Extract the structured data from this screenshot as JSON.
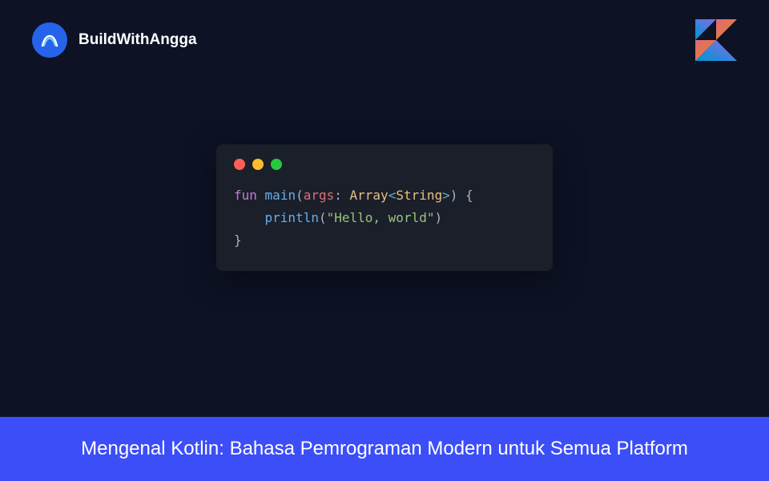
{
  "brand": {
    "name": "BuildWithAngga"
  },
  "code": {
    "line1": {
      "keyword": "fun",
      "func": "main",
      "paren_open": "(",
      "param": "args",
      "colon": ": ",
      "type": "Array",
      "lt": "<",
      "generic": "String",
      "gt": ">",
      "paren_close": ")",
      "brace_open": " {"
    },
    "line2": {
      "indent": "    ",
      "func": "println",
      "paren_open": "(",
      "string": "\"Hello, world\"",
      "paren_close": ")"
    },
    "line3": {
      "brace_close": "}"
    }
  },
  "footer": {
    "title": "Mengenal Kotlin: Bahasa Pemrograman Modern untuk Semua Platform"
  },
  "colors": {
    "background": "#0d1224",
    "accent": "#3b4ef8",
    "brand_blue": "#2563eb",
    "code_bg": "#1b1f2a"
  }
}
